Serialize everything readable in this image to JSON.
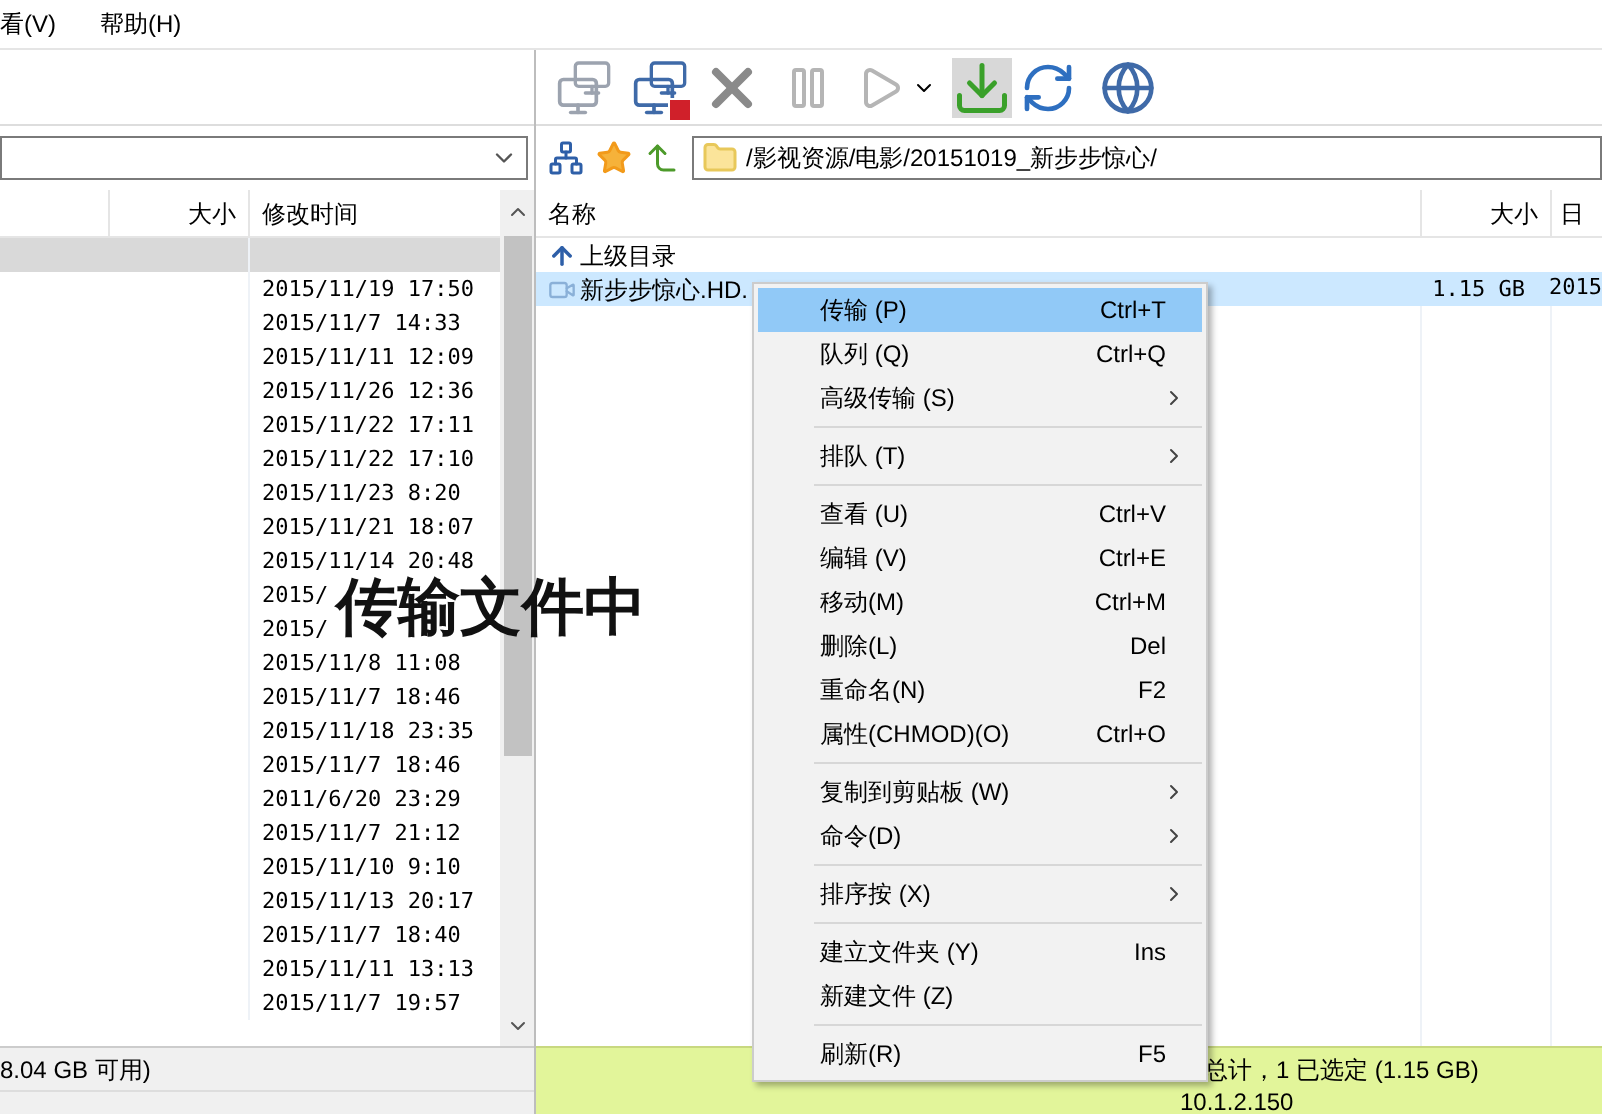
{
  "menu_bar": [
    "看(V)",
    "帮助(H)"
  ],
  "local": {
    "columns": [
      "大小",
      "修改时间"
    ],
    "rows": [
      {
        "modified": "",
        "selected": true
      },
      {
        "modified": "2015/11/19 17:50",
        "selected": false
      },
      {
        "modified": "2015/11/7 14:33",
        "selected": false
      },
      {
        "modified": "2015/11/11 12:09",
        "selected": false
      },
      {
        "modified": "2015/11/26 12:36",
        "selected": false
      },
      {
        "modified": "2015/11/22 17:11",
        "selected": false
      },
      {
        "modified": "2015/11/22 17:10",
        "selected": false
      },
      {
        "modified": "2015/11/23 8:20",
        "selected": false
      },
      {
        "modified": "2015/11/21 18:07",
        "selected": false
      },
      {
        "modified": "2015/11/14 20:48",
        "selected": false
      },
      {
        "modified": "2015/",
        "selected": false
      },
      {
        "modified": "2015/",
        "selected": false
      },
      {
        "modified": "2015/11/8 11:08",
        "selected": false
      },
      {
        "modified": "2015/11/7 18:46",
        "selected": false
      },
      {
        "modified": "2015/11/18 23:35",
        "selected": false
      },
      {
        "modified": "2015/11/7 18:46",
        "selected": false
      },
      {
        "modified": "2011/6/20 23:29",
        "selected": false
      },
      {
        "modified": "2015/11/7 21:12",
        "selected": false
      },
      {
        "modified": "2015/11/10 9:10",
        "selected": false
      },
      {
        "modified": "2015/11/13 20:17",
        "selected": false
      },
      {
        "modified": "2015/11/7 18:40",
        "selected": false
      },
      {
        "modified": "2015/11/11 13:13",
        "selected": false
      },
      {
        "modified": "2015/11/7 19:57",
        "selected": false
      }
    ],
    "status": "8.04 GB 可用)"
  },
  "remote": {
    "path": "/影视资源/电影/20151019_新步步惊心/",
    "columns": [
      "名称",
      "大小",
      "日"
    ],
    "rows": [
      {
        "kind": "parent",
        "name": "上级目录",
        "selected": false
      },
      {
        "kind": "video",
        "name": "新步步惊心.HD.",
        "size": "1.15 GB",
        "date": "2015",
        "selected": true
      }
    ],
    "status": "总计，1 已选定 (1.15 GB)",
    "address": "10.1.2.150"
  },
  "context_menu": [
    {
      "kind": "item",
      "label": "传输 (P)",
      "shortcut": "Ctrl+T",
      "submenu": false,
      "selected": true
    },
    {
      "kind": "item",
      "label": "队列 (Q)",
      "shortcut": "Ctrl+Q",
      "submenu": false,
      "selected": false
    },
    {
      "kind": "item",
      "label": "高级传输 (S)",
      "submenu": true,
      "selected": false
    },
    {
      "kind": "separator"
    },
    {
      "kind": "item",
      "label": "排队 (T)",
      "submenu": true,
      "selected": false
    },
    {
      "kind": "separator"
    },
    {
      "kind": "item",
      "label": "查看 (U)",
      "shortcut": "Ctrl+V",
      "submenu": false,
      "selected": false
    },
    {
      "kind": "item",
      "label": "编辑 (V)",
      "shortcut": "Ctrl+E",
      "submenu": false,
      "selected": false
    },
    {
      "kind": "item",
      "label": "移动(M)",
      "shortcut": "Ctrl+M",
      "submenu": false,
      "selected": false
    },
    {
      "kind": "item",
      "label": "删除(L)",
      "shortcut": "Del",
      "submenu": false,
      "selected": false
    },
    {
      "kind": "item",
      "label": "重命名(N)",
      "shortcut": "F2",
      "submenu": false,
      "selected": false
    },
    {
      "kind": "item",
      "label": "属性(CHMOD)(O)",
      "shortcut": "Ctrl+O",
      "submenu": false,
      "selected": false
    },
    {
      "kind": "separator"
    },
    {
      "kind": "item",
      "label": "复制到剪贴板 (W)",
      "submenu": true,
      "selected": false
    },
    {
      "kind": "item",
      "label": "命令(D)",
      "submenu": true,
      "selected": false
    },
    {
      "kind": "separator"
    },
    {
      "kind": "item",
      "label": "排序按 (X)",
      "submenu": true,
      "selected": false
    },
    {
      "kind": "separator"
    },
    {
      "kind": "item",
      "label": "建立文件夹 (Y)",
      "shortcut": "Ins",
      "submenu": false,
      "selected": false
    },
    {
      "kind": "item",
      "label": "新建文件 (Z)",
      "submenu": false,
      "selected": false
    },
    {
      "kind": "separator"
    },
    {
      "kind": "item",
      "label": "刷新(R)",
      "shortcut": "F5",
      "submenu": false,
      "selected": false
    }
  ],
  "annotation": "传输文件中"
}
